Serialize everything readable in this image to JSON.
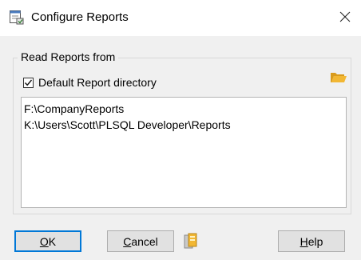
{
  "window": {
    "title": "Configure Reports"
  },
  "group": {
    "legend": "Read Reports from",
    "checkbox": {
      "label": "Default Report directory",
      "checked": true
    }
  },
  "directories": [
    "F:\\CompanyReports",
    "K:\\Users\\Scott\\PLSQL Developer\\Reports"
  ],
  "buttons": {
    "ok": {
      "prefix": "",
      "mnemonic": "O",
      "rest": "K"
    },
    "cancel": {
      "prefix": "",
      "mnemonic": "C",
      "rest": "ancel"
    },
    "help": {
      "prefix": "",
      "mnemonic": "H",
      "rest": "elp"
    }
  },
  "icons": {
    "title": "report-config-icon",
    "close": "close-icon",
    "folder": "folder-open-icon",
    "export": "export-icon"
  },
  "colors": {
    "accent": "#0078d7",
    "folder": "#f2b733"
  }
}
